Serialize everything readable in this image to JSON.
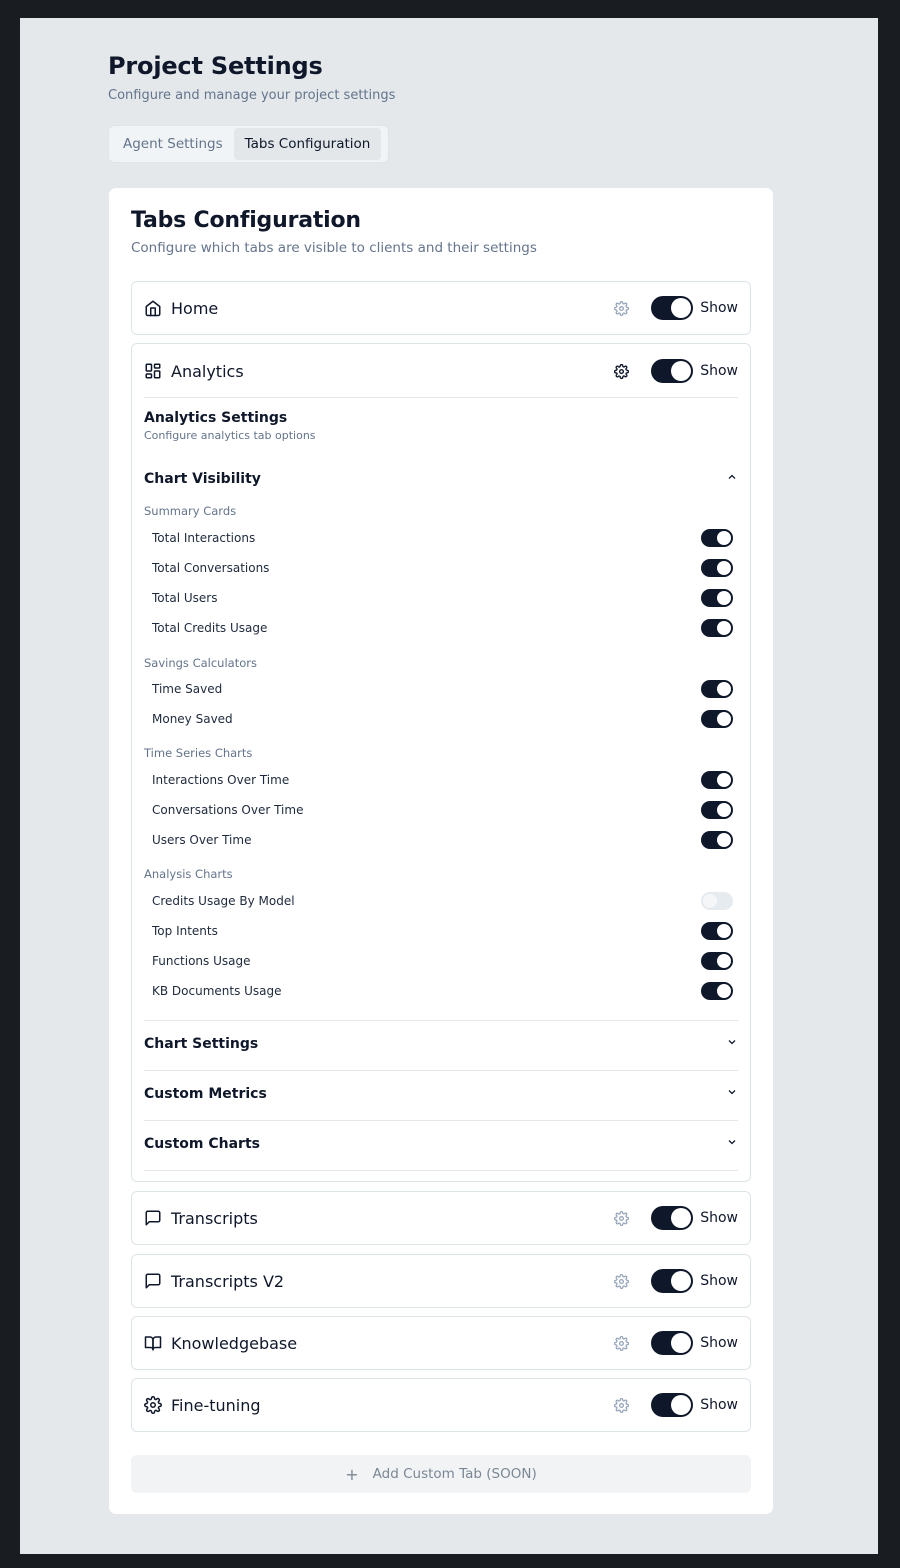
{
  "page": {
    "title": "Project Settings",
    "subtitle": "Configure and manage your project settings"
  },
  "tabs": [
    {
      "label": "Agent Settings",
      "active": false
    },
    {
      "label": "Tabs Configuration",
      "active": true
    }
  ],
  "card": {
    "title": "Tabs Configuration",
    "subtitle": "Configure which tabs are visible to clients and their settings"
  },
  "tab_rows": {
    "home": {
      "label": "Home",
      "icon": "home-icon",
      "show_label": "Show",
      "visible": true
    },
    "analytics": {
      "label": "Analytics",
      "icon": "dashboard-icon",
      "show_label": "Show",
      "visible": true
    },
    "transcripts": {
      "label": "Transcripts",
      "icon": "message-square-icon",
      "show_label": "Show",
      "visible": true
    },
    "transcripts_v2": {
      "label": "Transcripts V2",
      "icon": "message-square-icon",
      "show_label": "Show",
      "visible": true
    },
    "knowledgebase": {
      "label": "Knowledgebase",
      "icon": "book-open-icon",
      "show_label": "Show",
      "visible": true
    },
    "fine_tuning": {
      "label": "Fine-tuning",
      "icon": "gear-icon",
      "show_label": "Show",
      "visible": true
    }
  },
  "analytics_settings": {
    "title": "Analytics Settings",
    "subtitle": "Configure analytics tab options",
    "chart_visibility": {
      "label": "Chart Visibility",
      "expanded": true,
      "groups": [
        {
          "label": "Summary Cards",
          "items": [
            {
              "label": "Total Interactions",
              "on": true
            },
            {
              "label": "Total Conversations",
              "on": true
            },
            {
              "label": "Total Users",
              "on": true
            },
            {
              "label": "Total Credits Usage",
              "on": true
            }
          ]
        },
        {
          "label": "Savings Calculators",
          "items": [
            {
              "label": "Time Saved",
              "on": true
            },
            {
              "label": "Money Saved",
              "on": true
            }
          ]
        },
        {
          "label": "Time Series Charts",
          "items": [
            {
              "label": "Interactions Over Time",
              "on": true
            },
            {
              "label": "Conversations Over Time",
              "on": true
            },
            {
              "label": "Users Over Time",
              "on": true
            }
          ]
        },
        {
          "label": "Analysis Charts",
          "items": [
            {
              "label": "Credits Usage By Model",
              "on": false
            },
            {
              "label": "Top Intents",
              "on": true
            },
            {
              "label": "Functions Usage",
              "on": true
            },
            {
              "label": "KB Documents Usage",
              "on": true
            }
          ]
        }
      ]
    },
    "sections": [
      {
        "label": "Chart Settings",
        "expanded": false
      },
      {
        "label": "Custom Metrics",
        "expanded": false
      },
      {
        "label": "Custom Charts",
        "expanded": false
      }
    ]
  },
  "add_tab": {
    "label": "Add Custom Tab (SOON)"
  },
  "colors": {
    "frame_bg": "#e4e8eb",
    "outer_bg": "#191d21",
    "toggle_on": "#0f172a",
    "toggle_off": "#e6ebef",
    "muted_text": "#64748b"
  }
}
